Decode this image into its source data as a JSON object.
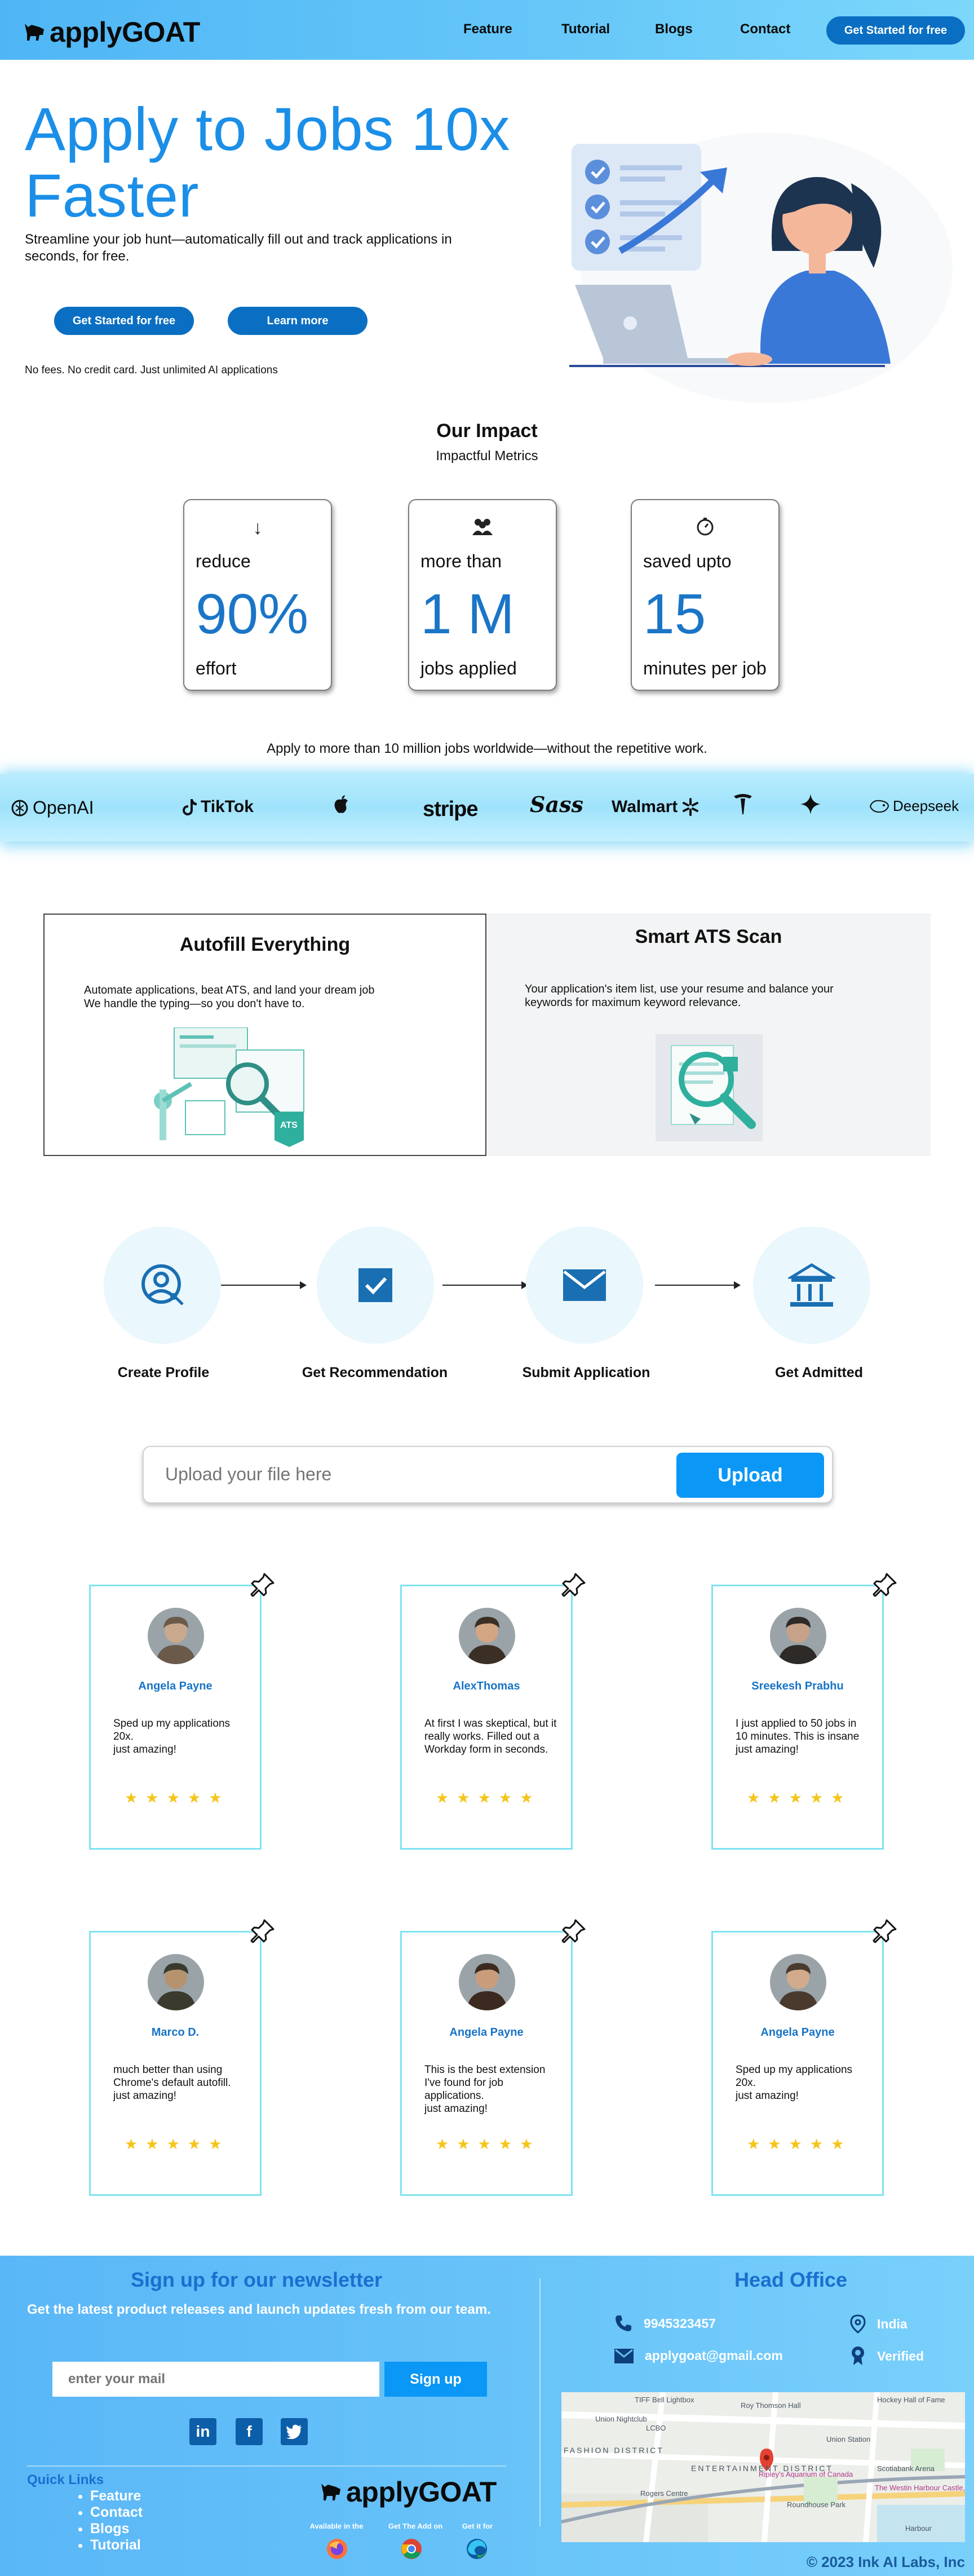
{
  "header": {
    "brand": "applyGOAT",
    "nav": [
      "Feature",
      "Tutorial",
      "Blogs",
      "Contact"
    ],
    "cta": "Get Started for free"
  },
  "hero": {
    "title": "Apply to Jobs 10x Faster",
    "subtitle": "Streamline your job hunt—automatically fill out and track applications in seconds, for free.",
    "primary_button": "Get Started for free",
    "secondary_button": "Learn more",
    "note": "No fees. No credit card. Just unlimited AI applications"
  },
  "impact": {
    "title": "Our Impact",
    "subtitle": "Impactful Metrics",
    "metrics": [
      {
        "icon": "arrow-down-icon",
        "top": "reduce",
        "value": "90%",
        "bottom": "effort"
      },
      {
        "icon": "people-icon",
        "top": "more than",
        "value": "1 M",
        "bottom": "jobs applied"
      },
      {
        "icon": "timer-icon",
        "top": "saved upto",
        "value": "15",
        "bottom": "minutes per job"
      }
    ]
  },
  "logos": {
    "intro": "Apply to more than 10 million jobs worldwide—without the repetitive work.",
    "items": [
      "OpenAI",
      "TikTok",
      "",
      "stripe",
      "Sass",
      "Walmart",
      "",
      "",
      "Deepseek"
    ]
  },
  "features": [
    {
      "title": "Autofill Everything",
      "text": "Automate applications, beat ATS, and land your dream job\nWe handle the typing—so you don't have to."
    },
    {
      "title": "Smart ATS Scan",
      "text": "Your application's item list, use your resume and balance your keywords for maximum keyword relevance."
    }
  ],
  "steps": [
    "Create Profile",
    "Get Recommendation",
    "Submit Application",
    "Get Admitted"
  ],
  "upload": {
    "placeholder": "Upload your file here",
    "button": "Upload"
  },
  "testimonials": [
    {
      "name": "Angela Payne",
      "text": "Sped up my applications 20x.\njust amazing!",
      "rating": 5
    },
    {
      "name": "AlexThomas",
      "text": "At first I was skeptical, but it really works. Filled out a Workday form in seconds.",
      "rating": 5
    },
    {
      "name": "Sreekesh Prabhu",
      "text": "I just applied to 50 jobs in 10 minutes. This is insane\njust amazing!",
      "rating": 5
    },
    {
      "name": "Marco D.",
      "text": "much better than using Chrome's default autofill.\njust amazing!",
      "rating": 5
    },
    {
      "name": "Angela Payne",
      "text": "This is the best extension I've found for job applications.\njust amazing!",
      "rating": 5
    },
    {
      "name": "Angela Payne",
      "text": "Sped up my applications 20x.\njust amazing!",
      "rating": 5
    }
  ],
  "footer": {
    "newsletter_title": "Sign up for our newsletter",
    "newsletter_sub": "Get the latest product releases and launch updates fresh from our team.",
    "email_placeholder": "enter your mail",
    "signup": "Sign up",
    "quick_links_title": "Quick Links",
    "quick_links": [
      "Feature",
      "Contact",
      "Blogs",
      "Tutorial"
    ],
    "brand": "applyGOAT",
    "available": [
      "Available in the",
      "Get The Add on",
      "Get it for"
    ],
    "head_office": "Head Office",
    "phone": "9945323457",
    "email": "applygoat@gmail.com",
    "country": "India",
    "verified": "Verified",
    "map_labels": [
      "TIFF Bell Lightbox",
      "Roy Thomson Hall",
      "Hockey Hall of Fame",
      "Union Nightclub",
      "LCBO",
      "Union Station",
      "Scotiabank Arena",
      "ENTERTAINMENT DISTRICT",
      "FASHION DISTRICT",
      "Rogers Centre",
      "Roundhouse Park",
      "Ripley's Aquarium of Canada",
      "The Westin Harbour Castle, Toronto",
      "Harbour"
    ],
    "copyright": "© 2023 Ink AI Labs, Inc"
  }
}
